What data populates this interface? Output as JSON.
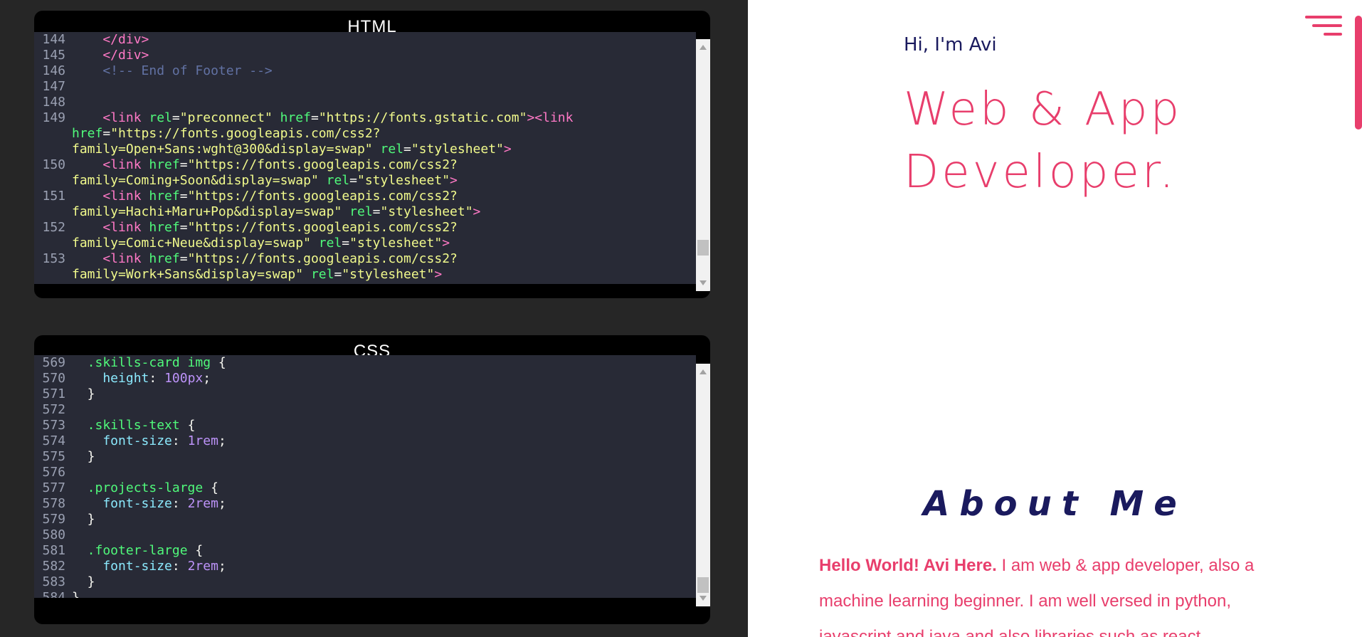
{
  "html_panel": {
    "title": "HTML",
    "lines": [
      {
        "n": "144",
        "parts": [
          {
            "c": "tag",
            "t": "    </div>"
          }
        ]
      },
      {
        "n": "145",
        "parts": [
          {
            "c": "tag",
            "t": "    </div>"
          }
        ]
      },
      {
        "n": "146",
        "parts": [
          {
            "c": "com",
            "t": "    <!-- End of Footer -->"
          }
        ]
      },
      {
        "n": "147",
        "parts": []
      },
      {
        "n": "148",
        "parts": []
      },
      {
        "n": "149",
        "parts": [
          {
            "c": "tag",
            "t": "    <link "
          },
          {
            "c": "attr",
            "t": "rel"
          },
          {
            "c": "pun",
            "t": "="
          },
          {
            "c": "str",
            "t": "\"preconnect\" "
          },
          {
            "c": "attr",
            "t": "href"
          },
          {
            "c": "pun",
            "t": "="
          },
          {
            "c": "str",
            "t": "\"https://fonts.gstatic.com\""
          },
          {
            "c": "tag",
            "t": "><link"
          }
        ]
      },
      {
        "n": "",
        "parts": [
          {
            "c": "attr",
            "t": "href"
          },
          {
            "c": "pun",
            "t": "="
          },
          {
            "c": "str",
            "t": "\"https://fonts.googleapis.com/css2?"
          }
        ]
      },
      {
        "n": "",
        "parts": [
          {
            "c": "str",
            "t": "family=Open+Sans:wght@300&display=swap\" "
          },
          {
            "c": "attr",
            "t": "rel"
          },
          {
            "c": "pun",
            "t": "="
          },
          {
            "c": "str",
            "t": "\"stylesheet\""
          },
          {
            "c": "tag",
            "t": ">"
          }
        ]
      },
      {
        "n": "150",
        "parts": [
          {
            "c": "tag",
            "t": "    <link "
          },
          {
            "c": "attr",
            "t": "href"
          },
          {
            "c": "pun",
            "t": "="
          },
          {
            "c": "str",
            "t": "\"https://fonts.googleapis.com/css2?"
          }
        ]
      },
      {
        "n": "",
        "parts": [
          {
            "c": "str",
            "t": "family=Coming+Soon&display=swap\" "
          },
          {
            "c": "attr",
            "t": "rel"
          },
          {
            "c": "pun",
            "t": "="
          },
          {
            "c": "str",
            "t": "\"stylesheet\""
          },
          {
            "c": "tag",
            "t": ">"
          }
        ]
      },
      {
        "n": "151",
        "parts": [
          {
            "c": "tag",
            "t": "    <link "
          },
          {
            "c": "attr",
            "t": "href"
          },
          {
            "c": "pun",
            "t": "="
          },
          {
            "c": "str",
            "t": "\"https://fonts.googleapis.com/css2?"
          }
        ]
      },
      {
        "n": "",
        "parts": [
          {
            "c": "str",
            "t": "family=Hachi+Maru+Pop&display=swap\" "
          },
          {
            "c": "attr",
            "t": "rel"
          },
          {
            "c": "pun",
            "t": "="
          },
          {
            "c": "str",
            "t": "\"stylesheet\""
          },
          {
            "c": "tag",
            "t": ">"
          }
        ]
      },
      {
        "n": "152",
        "parts": [
          {
            "c": "tag",
            "t": "    <link "
          },
          {
            "c": "attr",
            "t": "href"
          },
          {
            "c": "pun",
            "t": "="
          },
          {
            "c": "str",
            "t": "\"https://fonts.googleapis.com/css2?"
          }
        ]
      },
      {
        "n": "",
        "parts": [
          {
            "c": "str",
            "t": "family=Comic+Neue&display=swap\" "
          },
          {
            "c": "attr",
            "t": "rel"
          },
          {
            "c": "pun",
            "t": "="
          },
          {
            "c": "str",
            "t": "\"stylesheet\""
          },
          {
            "c": "tag",
            "t": ">"
          }
        ]
      },
      {
        "n": "153",
        "parts": [
          {
            "c": "tag",
            "t": "    <link "
          },
          {
            "c": "attr",
            "t": "href"
          },
          {
            "c": "pun",
            "t": "="
          },
          {
            "c": "str",
            "t": "\"https://fonts.googleapis.com/css2?"
          }
        ]
      },
      {
        "n": "",
        "parts": [
          {
            "c": "str",
            "t": "family=Work+Sans&display=swap\" "
          },
          {
            "c": "attr",
            "t": "rel"
          },
          {
            "c": "pun",
            "t": "="
          },
          {
            "c": "str",
            "t": "\"stylesheet\""
          },
          {
            "c": "tag",
            "t": ">"
          }
        ]
      }
    ]
  },
  "css_panel": {
    "title": "CSS",
    "lines": [
      {
        "n": "569",
        "parts": [
          {
            "c": "sel",
            "t": "  .skills-card img "
          },
          {
            "c": "pun",
            "t": "{"
          }
        ]
      },
      {
        "n": "570",
        "parts": [
          {
            "c": "prop",
            "t": "    height"
          },
          {
            "c": "pun",
            "t": ": "
          },
          {
            "c": "num",
            "t": "100px"
          },
          {
            "c": "pun",
            "t": ";"
          }
        ]
      },
      {
        "n": "571",
        "parts": [
          {
            "c": "pun",
            "t": "  }"
          }
        ]
      },
      {
        "n": "572",
        "parts": []
      },
      {
        "n": "573",
        "parts": [
          {
            "c": "sel",
            "t": "  .skills-text "
          },
          {
            "c": "pun",
            "t": "{"
          }
        ]
      },
      {
        "n": "574",
        "parts": [
          {
            "c": "prop",
            "t": "    font-size"
          },
          {
            "c": "pun",
            "t": ": "
          },
          {
            "c": "num",
            "t": "1rem"
          },
          {
            "c": "pun",
            "t": ";"
          }
        ]
      },
      {
        "n": "575",
        "parts": [
          {
            "c": "pun",
            "t": "  }"
          }
        ]
      },
      {
        "n": "576",
        "parts": []
      },
      {
        "n": "577",
        "parts": [
          {
            "c": "sel",
            "t": "  .projects-large "
          },
          {
            "c": "pun",
            "t": "{"
          }
        ]
      },
      {
        "n": "578",
        "parts": [
          {
            "c": "prop",
            "t": "    font-size"
          },
          {
            "c": "pun",
            "t": ": "
          },
          {
            "c": "num",
            "t": "2rem"
          },
          {
            "c": "pun",
            "t": ";"
          }
        ]
      },
      {
        "n": "579",
        "parts": [
          {
            "c": "pun",
            "t": "  }"
          }
        ]
      },
      {
        "n": "580",
        "parts": []
      },
      {
        "n": "581",
        "parts": [
          {
            "c": "sel",
            "t": "  .footer-large "
          },
          {
            "c": "pun",
            "t": "{"
          }
        ]
      },
      {
        "n": "582",
        "parts": [
          {
            "c": "prop",
            "t": "    font-size"
          },
          {
            "c": "pun",
            "t": ": "
          },
          {
            "c": "num",
            "t": "2rem"
          },
          {
            "c": "pun",
            "t": ";"
          }
        ]
      },
      {
        "n": "583",
        "parts": [
          {
            "c": "pun",
            "t": "  }"
          }
        ]
      },
      {
        "n": "584",
        "parts": [
          {
            "c": "pun",
            "t": "}"
          }
        ]
      }
    ]
  },
  "preview": {
    "greeting": "Hi, I'm Avi",
    "headline_line1": "Web & App",
    "headline_line2": "Developer.",
    "about_title": "About Me",
    "about_bold": "Hello World! Avi Here.",
    "about_text": " I am web & app developer, also a machine learning beginner. I am well versed in python, javascript and java.and also libraries such as react,",
    "menu_icon": "hamburger-menu-icon",
    "accent_color": "#e83e6c",
    "navy_color": "#1a1a5e"
  }
}
